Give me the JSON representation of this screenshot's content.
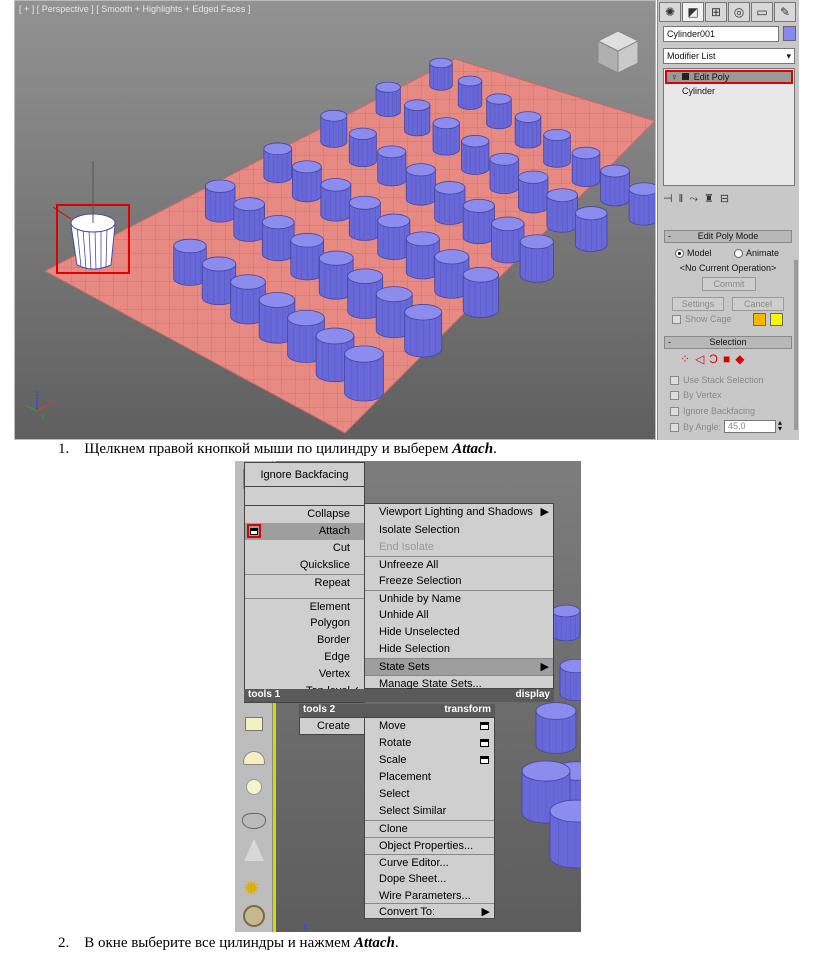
{
  "viewport": {
    "label": "[ + ] [ Perspective ] [ Smooth + Highlights + Edged Faces ]"
  },
  "command_panel": {
    "tabs": [
      "create-icon",
      "modify-icon",
      "hierarchy-icon",
      "motion-icon",
      "display-icon",
      "utilities-icon"
    ],
    "object_name": "Cylinder001",
    "object_color": "#8888ee",
    "modifier_list": "Modifier List",
    "stack": {
      "item1": "Edit Poly",
      "item2": "Cylinder"
    },
    "edit_poly_mode": {
      "title": "Edit Poly Mode",
      "model": "Model",
      "animate": "Animate",
      "current_op": "<No Current Operation>",
      "commit": "Commit",
      "settings": "Settings",
      "cancel": "Cancel",
      "show_cage": "Show Cage",
      "cage_colors": [
        "#f5b800",
        "#f5f500"
      ]
    },
    "selection": {
      "title": "Selection",
      "use_stack": "Use Stack Selection",
      "by_vertex": "By Vertex",
      "ignore_backfacing": "Ignore Backfacing",
      "by_angle": "By Angle:",
      "angle_value": "45,0"
    }
  },
  "captions": {
    "step1_num": "1.",
    "step1_text": "Щелкнем правой кнопкой мыши по цилиндру и выберем ",
    "step1_bold": "Attach",
    "step1_end": ".",
    "step2_num": "2.",
    "step2_text": "В окне выберите все цилиндры и нажмем ",
    "step2_bold": "Attach",
    "step2_end": "."
  },
  "quad_menu": {
    "tools1_top": "Ignore Backfacing",
    "tools1": [
      "Collapse",
      "Attach",
      "Cut",
      "Quickslice",
      "Repeat",
      "Element",
      "Polygon",
      "Border",
      "Edge",
      "Vertex",
      "Top-level"
    ],
    "tools1_label": "tools 1",
    "tools2_label": "tools 2",
    "tools2": [
      "Create"
    ],
    "display": [
      "Viewport Lighting and Shadows",
      "Isolate Selection",
      "End Isolate",
      "Unfreeze All",
      "Freeze Selection",
      "Unhide by Name",
      "Unhide All",
      "Hide Unselected",
      "Hide Selection",
      "State Sets",
      "Manage State Sets..."
    ],
    "display_label": "display",
    "transform_label": "transform",
    "transform": [
      "Move",
      "Rotate",
      "Scale",
      "Placement",
      "Select",
      "Select Similar",
      "Clone",
      "Object Properties...",
      "Curve Editor...",
      "Dope Sheet...",
      "Wire Parameters...",
      "Convert To:"
    ],
    "check": "✓",
    "submenu_arrow": "▶"
  },
  "axis": {
    "x": "x",
    "y": "y",
    "z": "z"
  }
}
